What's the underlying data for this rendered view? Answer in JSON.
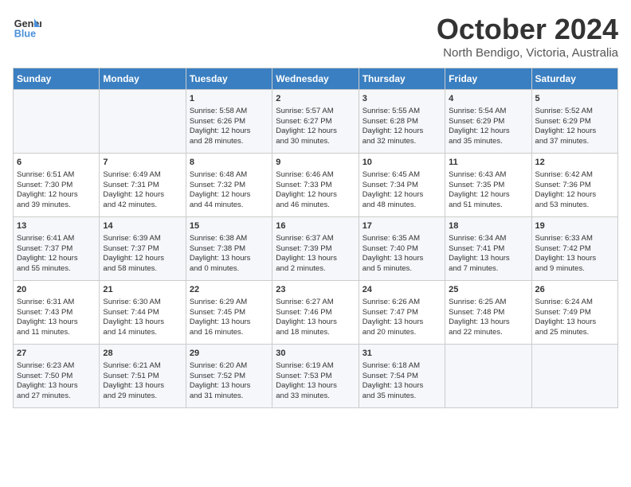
{
  "header": {
    "logo_line1": "General",
    "logo_line2": "Blue",
    "month": "October 2024",
    "location": "North Bendigo, Victoria, Australia"
  },
  "weekdays": [
    "Sunday",
    "Monday",
    "Tuesday",
    "Wednesday",
    "Thursday",
    "Friday",
    "Saturday"
  ],
  "weeks": [
    [
      {
        "day": "",
        "info": ""
      },
      {
        "day": "",
        "info": ""
      },
      {
        "day": "1",
        "info": "Sunrise: 5:58 AM\nSunset: 6:26 PM\nDaylight: 12 hours\nand 28 minutes."
      },
      {
        "day": "2",
        "info": "Sunrise: 5:57 AM\nSunset: 6:27 PM\nDaylight: 12 hours\nand 30 minutes."
      },
      {
        "day": "3",
        "info": "Sunrise: 5:55 AM\nSunset: 6:28 PM\nDaylight: 12 hours\nand 32 minutes."
      },
      {
        "day": "4",
        "info": "Sunrise: 5:54 AM\nSunset: 6:29 PM\nDaylight: 12 hours\nand 35 minutes."
      },
      {
        "day": "5",
        "info": "Sunrise: 5:52 AM\nSunset: 6:29 PM\nDaylight: 12 hours\nand 37 minutes."
      }
    ],
    [
      {
        "day": "6",
        "info": "Sunrise: 6:51 AM\nSunset: 7:30 PM\nDaylight: 12 hours\nand 39 minutes."
      },
      {
        "day": "7",
        "info": "Sunrise: 6:49 AM\nSunset: 7:31 PM\nDaylight: 12 hours\nand 42 minutes."
      },
      {
        "day": "8",
        "info": "Sunrise: 6:48 AM\nSunset: 7:32 PM\nDaylight: 12 hours\nand 44 minutes."
      },
      {
        "day": "9",
        "info": "Sunrise: 6:46 AM\nSunset: 7:33 PM\nDaylight: 12 hours\nand 46 minutes."
      },
      {
        "day": "10",
        "info": "Sunrise: 6:45 AM\nSunset: 7:34 PM\nDaylight: 12 hours\nand 48 minutes."
      },
      {
        "day": "11",
        "info": "Sunrise: 6:43 AM\nSunset: 7:35 PM\nDaylight: 12 hours\nand 51 minutes."
      },
      {
        "day": "12",
        "info": "Sunrise: 6:42 AM\nSunset: 7:36 PM\nDaylight: 12 hours\nand 53 minutes."
      }
    ],
    [
      {
        "day": "13",
        "info": "Sunrise: 6:41 AM\nSunset: 7:37 PM\nDaylight: 12 hours\nand 55 minutes."
      },
      {
        "day": "14",
        "info": "Sunrise: 6:39 AM\nSunset: 7:37 PM\nDaylight: 12 hours\nand 58 minutes."
      },
      {
        "day": "15",
        "info": "Sunrise: 6:38 AM\nSunset: 7:38 PM\nDaylight: 13 hours\nand 0 minutes."
      },
      {
        "day": "16",
        "info": "Sunrise: 6:37 AM\nSunset: 7:39 PM\nDaylight: 13 hours\nand 2 minutes."
      },
      {
        "day": "17",
        "info": "Sunrise: 6:35 AM\nSunset: 7:40 PM\nDaylight: 13 hours\nand 5 minutes."
      },
      {
        "day": "18",
        "info": "Sunrise: 6:34 AM\nSunset: 7:41 PM\nDaylight: 13 hours\nand 7 minutes."
      },
      {
        "day": "19",
        "info": "Sunrise: 6:33 AM\nSunset: 7:42 PM\nDaylight: 13 hours\nand 9 minutes."
      }
    ],
    [
      {
        "day": "20",
        "info": "Sunrise: 6:31 AM\nSunset: 7:43 PM\nDaylight: 13 hours\nand 11 minutes."
      },
      {
        "day": "21",
        "info": "Sunrise: 6:30 AM\nSunset: 7:44 PM\nDaylight: 13 hours\nand 14 minutes."
      },
      {
        "day": "22",
        "info": "Sunrise: 6:29 AM\nSunset: 7:45 PM\nDaylight: 13 hours\nand 16 minutes."
      },
      {
        "day": "23",
        "info": "Sunrise: 6:27 AM\nSunset: 7:46 PM\nDaylight: 13 hours\nand 18 minutes."
      },
      {
        "day": "24",
        "info": "Sunrise: 6:26 AM\nSunset: 7:47 PM\nDaylight: 13 hours\nand 20 minutes."
      },
      {
        "day": "25",
        "info": "Sunrise: 6:25 AM\nSunset: 7:48 PM\nDaylight: 13 hours\nand 22 minutes."
      },
      {
        "day": "26",
        "info": "Sunrise: 6:24 AM\nSunset: 7:49 PM\nDaylight: 13 hours\nand 25 minutes."
      }
    ],
    [
      {
        "day": "27",
        "info": "Sunrise: 6:23 AM\nSunset: 7:50 PM\nDaylight: 13 hours\nand 27 minutes."
      },
      {
        "day": "28",
        "info": "Sunrise: 6:21 AM\nSunset: 7:51 PM\nDaylight: 13 hours\nand 29 minutes."
      },
      {
        "day": "29",
        "info": "Sunrise: 6:20 AM\nSunset: 7:52 PM\nDaylight: 13 hours\nand 31 minutes."
      },
      {
        "day": "30",
        "info": "Sunrise: 6:19 AM\nSunset: 7:53 PM\nDaylight: 13 hours\nand 33 minutes."
      },
      {
        "day": "31",
        "info": "Sunrise: 6:18 AM\nSunset: 7:54 PM\nDaylight: 13 hours\nand 35 minutes."
      },
      {
        "day": "",
        "info": ""
      },
      {
        "day": "",
        "info": ""
      }
    ]
  ]
}
